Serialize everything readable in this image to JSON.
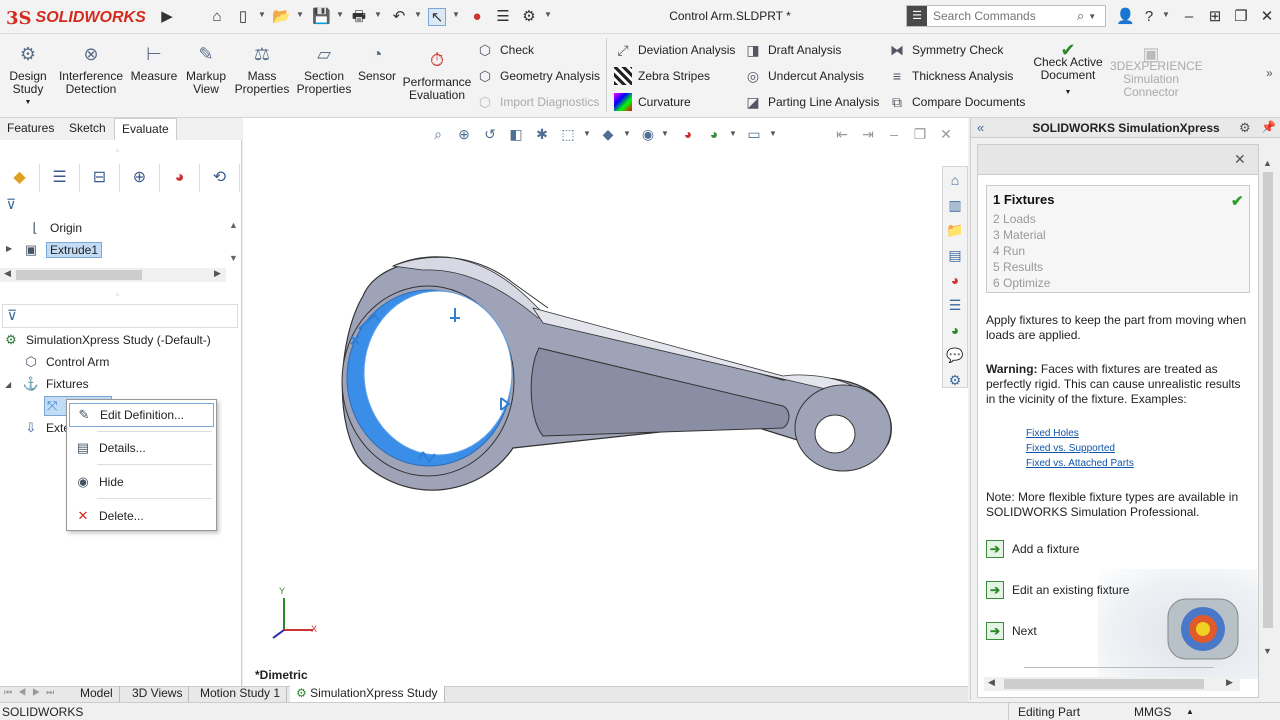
{
  "app": {
    "brand_prefix": "3S",
    "brand_name": "SOLIDWORKS"
  },
  "title": {
    "document": "Control Arm.SLDPRT *"
  },
  "search": {
    "placeholder": "Search Commands"
  },
  "ribbon": {
    "design_study": "Design Study",
    "interference": "Interference Detection",
    "measure": "Measure",
    "markup": "Markup View",
    "mass": "Mass Properties",
    "section": "Section Properties",
    "sensor": "Sensor",
    "performance": "Performance Evaluation",
    "check": "Check",
    "geometry": "Geometry Analysis",
    "import_diag": "Import Diagnostics",
    "deviation": "Deviation Analysis",
    "zebra": "Zebra Stripes",
    "curvature": "Curvature",
    "draft": "Draft Analysis",
    "undercut": "Undercut Analysis",
    "parting": "Parting Line Analysis",
    "symmetry": "Symmetry Check",
    "thickness": "Thickness Analysis",
    "compare": "Compare Documents",
    "check_active": "Check Active Document",
    "threedx": "3DEXPERIENCE Simulation Connector"
  },
  "cm_tabs": [
    "Features",
    "Sketch",
    "Evaluate"
  ],
  "tree_top": {
    "origin": "Origin",
    "extrude": "Extrude1"
  },
  "tree_sim": {
    "study": "SimulationXpress Study (-Default-)",
    "part": "Control Arm",
    "fixtures": "Fixtures",
    "external": "Exte"
  },
  "context_menu": {
    "edit": "Edit Definition...",
    "details": "Details...",
    "hide": "Hide",
    "delete": "Delete..."
  },
  "viewport": {
    "view_name": "*Dimetric",
    "axis_x": "X",
    "axis_y": "Y"
  },
  "taskpane": {
    "title": "SOLIDWORKS SimulationXpress",
    "steps": [
      {
        "num": "1",
        "label": "Fixtures"
      },
      {
        "num": "2",
        "label": "Loads"
      },
      {
        "num": "3",
        "label": "Material"
      },
      {
        "num": "4",
        "label": "Run"
      },
      {
        "num": "5",
        "label": "Results"
      },
      {
        "num": "6",
        "label": "Optimize"
      }
    ],
    "intro": "Apply fixtures to keep the part from moving when loads are applied.",
    "warning_label": "Warning:",
    "warning_text": " Faces with fixtures are treated as perfectly rigid. This can cause unrealistic results in the vicinity of the fixture. Examples:",
    "links": [
      "Fixed Holes",
      "Fixed vs. Supported",
      "Fixed vs. Attached Parts"
    ],
    "note": "Note: More flexible fixture types are available in SOLIDWORKS Simulation Professional.",
    "actions": [
      "Add a fixture",
      "Edit an existing fixture",
      "Next"
    ]
  },
  "bottom_tabs": [
    "Model",
    "3D Views",
    "Motion Study 1",
    "SimulationXpress Study"
  ],
  "status": {
    "app": "SOLIDWORKS",
    "mode": "Editing Part",
    "units": "MMGS"
  },
  "colors": {
    "brand_red": "#d52b1e",
    "part_face": "#9fa3b8",
    "fixture_face": "#3b8ee8",
    "fixture_marker": "#2f7fd6"
  }
}
